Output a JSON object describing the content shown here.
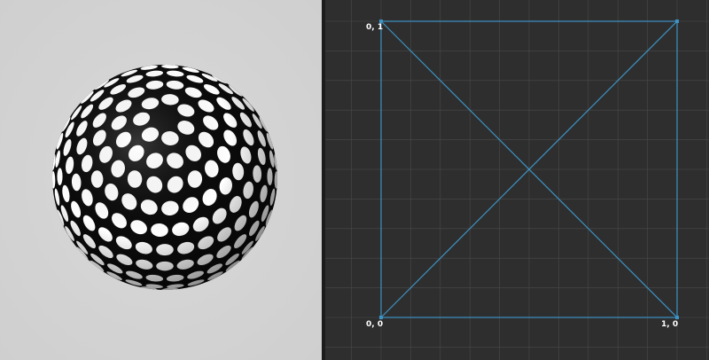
{
  "preview": {
    "background_color": "#d3d3d3",
    "object": "sphere",
    "texture": "polka-dot",
    "dot_color": "#ffffff",
    "base_color": "#0b0b0b"
  },
  "uv_editor": {
    "background_color": "#2e2e2e",
    "grid_color": "#4a4a4a",
    "edge_color": "#3d93c4",
    "labels": {
      "top_left": "0, 1",
      "bottom_left": "0, 0",
      "bottom_right": "1, 0"
    }
  }
}
